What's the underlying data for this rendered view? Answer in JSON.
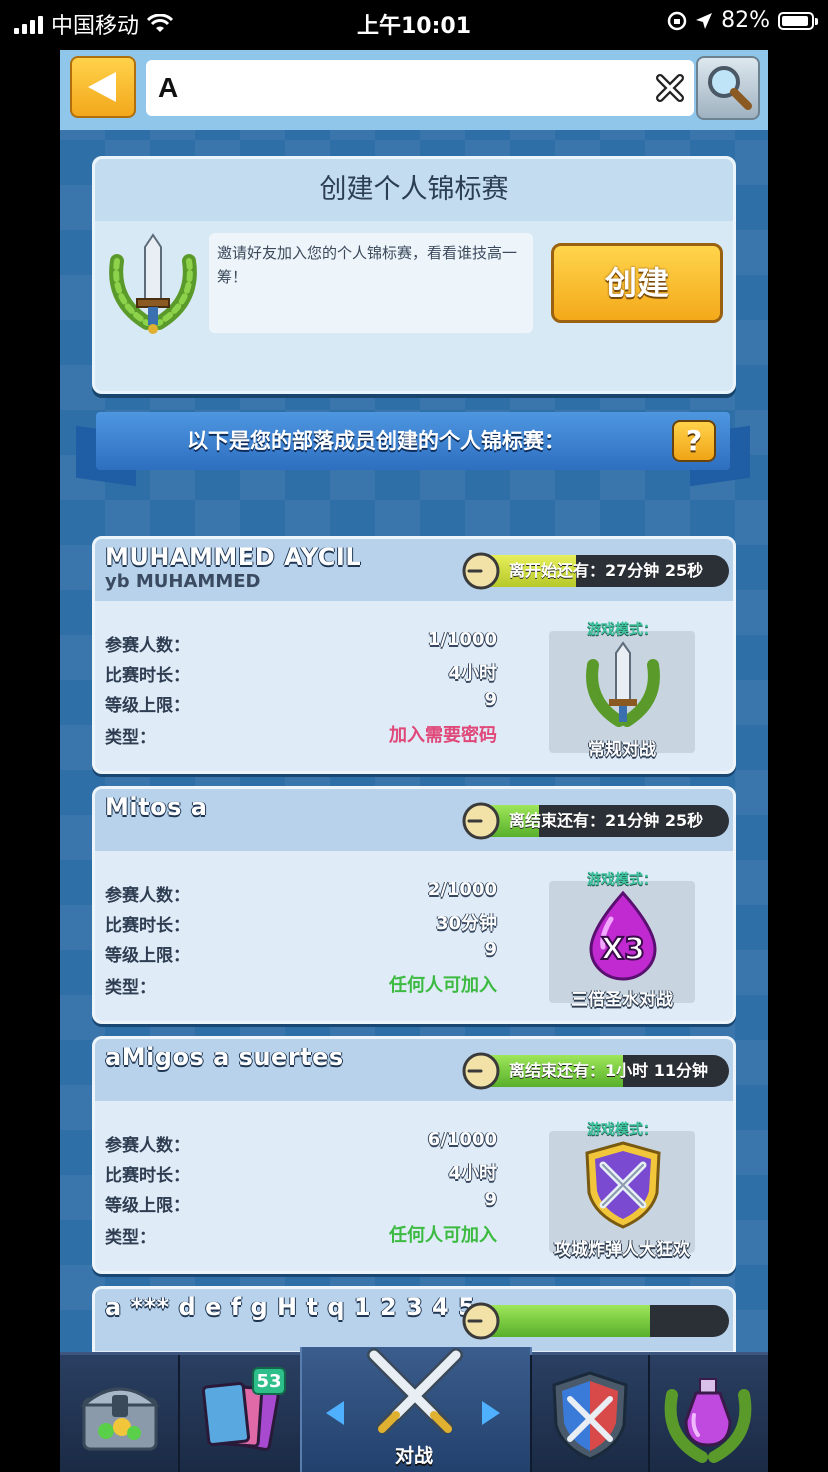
{
  "status_bar": {
    "carrier": "中国移动",
    "time": "上午10:01",
    "battery": "82%"
  },
  "search": {
    "value": "A"
  },
  "create_panel": {
    "title": "创建个人锦标赛",
    "description": "邀请好友加入您的个人锦标赛，看看谁技高一筹！",
    "button": "创建"
  },
  "clan_banner": {
    "text": "以下是您的部落成员创建的个人锦标赛：",
    "help": "?"
  },
  "labels": {
    "players": "参赛人数：",
    "duration": "比赛时长：",
    "level_cap": "等级上限：",
    "type": "类型：",
    "game_mode": "游戏模式："
  },
  "tournaments": [
    {
      "name": "MUHAMMED AYCIL",
      "creator": "yb MUHAMMED",
      "timer_label": "离开始还有：",
      "timer_value": "27分钟 25秒",
      "timer_progress": 0.42,
      "players": "1/1000",
      "duration": "4小时",
      "level_cap": "9",
      "type": "加入需要密码",
      "type_color": "#e0487a",
      "mode": "常规对战"
    },
    {
      "name": "Mitos a",
      "creator": "",
      "timer_label": "离结束还有：",
      "timer_value": "21分钟 25秒",
      "timer_progress": 0.28,
      "players": "2/1000",
      "duration": "30分钟",
      "level_cap": "9",
      "type": "任何人可加入",
      "type_color": "#3dba42",
      "mode": "三倍圣水对战"
    },
    {
      "name": "aMigos a suertes",
      "creator": "",
      "timer_label": "离结束还有：",
      "timer_value": "1小时 11分钟",
      "timer_progress": 0.6,
      "players": "6/1000",
      "duration": "4小时",
      "level_cap": "9",
      "type": "任何人可加入",
      "type_color": "#3dba42",
      "mode": "攻城炸弹人大狂欢"
    },
    {
      "name": "a *** d e f g H t q 1 2 3 4 5",
      "creator": "",
      "timer_progress": 0.7
    }
  ],
  "bottom_nav": {
    "cards_badge": "53",
    "battle_label": "对战"
  },
  "colors": {
    "accent_yellow": "#f4a91a",
    "timer_green": "#58b02a",
    "timer_yellow": "#b6c82a",
    "game_bg": "#2f6fa8"
  }
}
